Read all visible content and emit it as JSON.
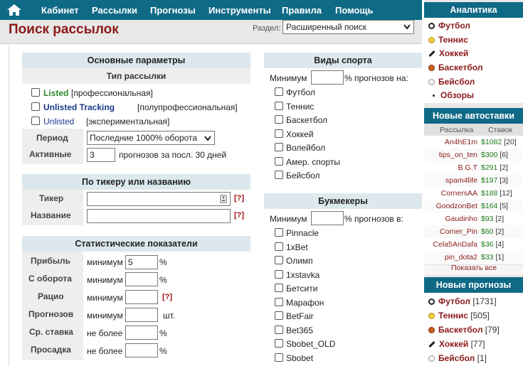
{
  "nav": {
    "items": [
      "Кабинет",
      "Рассылки",
      "Прогнозы",
      "Инструменты",
      "Правила",
      "Помощь"
    ]
  },
  "page": {
    "title": "Поиск рассылок",
    "section_label": "Раздел:",
    "section_value": "Расширенный поиск"
  },
  "basic": {
    "header": "Основные параметры",
    "type_header": "Тип рассылки",
    "types": [
      {
        "name": "Listed",
        "desc": "[профессиональная]",
        "color": "#2a8a2a"
      },
      {
        "name": "Unlisted Tracking",
        "desc": "[полупрофессиональная]",
        "color": "#1a3a8a"
      },
      {
        "name": "Unlisted",
        "desc": "[экспериментальная]",
        "color": "#1a3a8a"
      }
    ],
    "period_label": "Период",
    "period_value": "Последние 1000% оборота",
    "active_label": "Активные",
    "active_value": "3",
    "active_suffix": "прогнозов за посл. 30 дней"
  },
  "ticker": {
    "header": "По тикеру или названию",
    "ticker_label": "Тикер",
    "name_label": "Название",
    "help": "[?]"
  },
  "stats": {
    "header": "Статистические показатели",
    "rows": [
      {
        "label": "Прибыль",
        "prefix": "минимум",
        "value": "5",
        "suffix": "%"
      },
      {
        "label": "С оборота",
        "prefix": "минимум",
        "value": "",
        "suffix": "%"
      },
      {
        "label": "Рацио",
        "prefix": "минимум",
        "value": "",
        "suffix": "[?]"
      },
      {
        "label": "Прогнозов",
        "prefix": "минимум",
        "value": "",
        "suffix": "шт."
      },
      {
        "label": "Ср. ставка",
        "prefix": "не более",
        "value": "",
        "suffix": "%"
      },
      {
        "label": "Просадка",
        "prefix": "не более",
        "value": "",
        "suffix": "%"
      }
    ]
  },
  "sports": {
    "header": "Виды спорта",
    "min_label": "Минимум",
    "min_suffix": "% прогнозов на:",
    "items": [
      "Футбол",
      "Теннис",
      "Баскетбол",
      "Хоккей",
      "Волейбол",
      "Амер. спорты",
      "Бейсбол"
    ]
  },
  "bookmakers": {
    "header": "Букмекеры",
    "min_label": "Минимум",
    "min_suffix": "% прогнозов в:",
    "items": [
      "Pinnacle",
      "1xBet",
      "Олимп",
      "1xstavka",
      "Бетсити",
      "Марафон",
      "BetFair",
      "Bet365",
      "Sbobet_OLD",
      "Sbobet"
    ]
  },
  "sidebar": {
    "analytics_header": "Аналитика",
    "analytics": [
      {
        "label": "Футбол",
        "icon": "soccer-ball-icon"
      },
      {
        "label": "Теннис",
        "icon": "tennis-ball-icon"
      },
      {
        "label": "Хоккей",
        "icon": "hockey-stick-icon"
      },
      {
        "label": "Баскетбол",
        "icon": "basketball-icon"
      },
      {
        "label": "Бейсбол",
        "icon": "baseball-icon"
      },
      {
        "label": "Обзоры",
        "icon": "bullet-icon"
      }
    ],
    "autobets_header": "Новые автоставки",
    "autobets_cols": [
      "Рассылка",
      "Ставок"
    ],
    "autobets": [
      {
        "name": "An4hE1m",
        "sum": "$1082",
        "count": "[20]"
      },
      {
        "name": "tips_on_ten",
        "sum": "$300",
        "count": "[6]"
      },
      {
        "name": "B.G.T",
        "sum": "$291",
        "count": "[2]"
      },
      {
        "name": "spam4life",
        "sum": "$197",
        "count": "[3]"
      },
      {
        "name": "CornersAA",
        "sum": "$188",
        "count": "[12]"
      },
      {
        "name": "GoodzonBet",
        "sum": "$164",
        "count": "[5]"
      },
      {
        "name": "Gaudinho",
        "sum": "$93",
        "count": "[2]"
      },
      {
        "name": "Corner_Pin",
        "sum": "$60",
        "count": "[2]"
      },
      {
        "name": "Cela5AnDafa",
        "sum": "$36",
        "count": "[4]"
      },
      {
        "name": "pin_dota2",
        "sum": "$33",
        "count": "[1]"
      }
    ],
    "show_all": "Показать все",
    "forecasts_header": "Новые прогнозы",
    "forecasts": [
      {
        "label": "Футбол",
        "count": "[1731]",
        "icon": "soccer-ball-icon"
      },
      {
        "label": "Теннис",
        "count": "[505]",
        "icon": "tennis-ball-icon"
      },
      {
        "label": "Баскетбол",
        "count": "[79]",
        "icon": "basketball-icon"
      },
      {
        "label": "Хоккей",
        "count": "[77]",
        "icon": "hockey-stick-icon"
      },
      {
        "label": "Бейсбол",
        "count": "[1]",
        "icon": "baseball-icon"
      }
    ]
  }
}
